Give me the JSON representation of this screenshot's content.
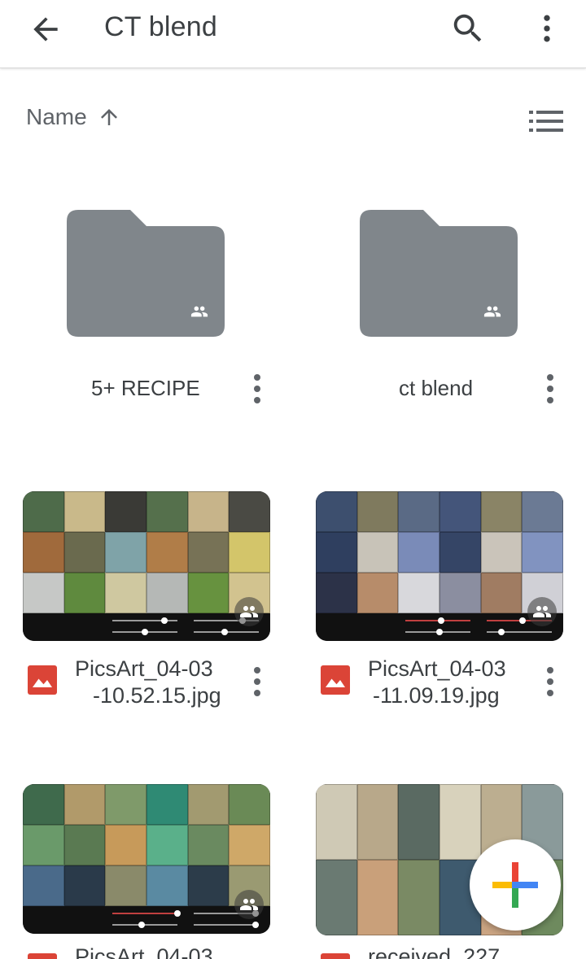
{
  "appbar": {
    "title": "CT blend",
    "back_icon": "arrow-back-icon",
    "search_icon": "search-icon",
    "more_icon": "more-vert-icon"
  },
  "sort": {
    "label": "Name",
    "direction_icon": "arrow-upward-icon",
    "view_icon": "list-view-icon"
  },
  "folders": [
    {
      "name": "5+ RECIPE",
      "shared": true
    },
    {
      "name": "ct blend",
      "shared": true
    }
  ],
  "files": [
    {
      "name_line1": "PicsArt_04-03",
      "name_line2": "-10.52.15.jpg",
      "type_icon": "image-file-icon",
      "shared": true
    },
    {
      "name_line1": "PicsArt_04-03",
      "name_line2": "-11.09.19.jpg",
      "type_icon": "image-file-icon",
      "shared": true
    },
    {
      "name_line1": "PicsArt_04-03",
      "name_line2": "",
      "type_icon": "image-file-icon",
      "shared": true
    },
    {
      "name_line1": "received_227",
      "name_line2": "",
      "type_icon": "image-file-icon",
      "shared": false
    }
  ],
  "fab": {
    "icon": "add-icon"
  },
  "colors": {
    "folder": "#80868b",
    "file_icon": "#db4437",
    "google_blue": "#4285f4",
    "google_red": "#ea4335",
    "google_yellow": "#fbbc04",
    "google_green": "#34a853"
  }
}
